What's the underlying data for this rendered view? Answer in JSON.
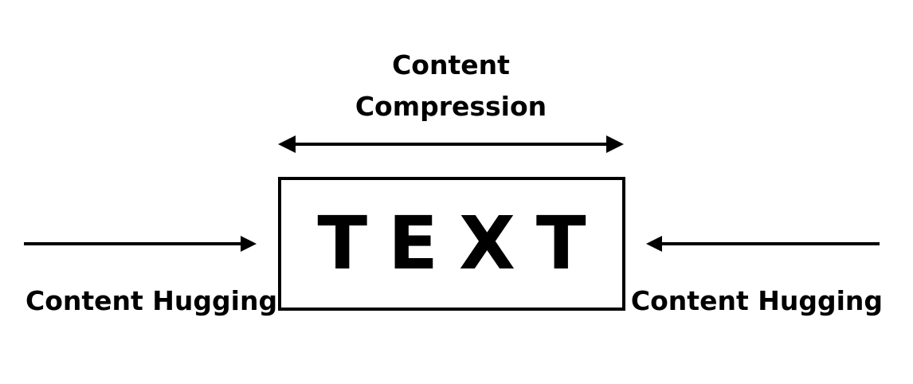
{
  "title": {
    "line1": "Content",
    "line2": "Compression"
  },
  "box": {
    "text": "TEXT"
  },
  "left_label": "Content Hugging",
  "right_label": "Content Hugging",
  "colors": {
    "ink": "#000000",
    "background": "#ffffff"
  }
}
